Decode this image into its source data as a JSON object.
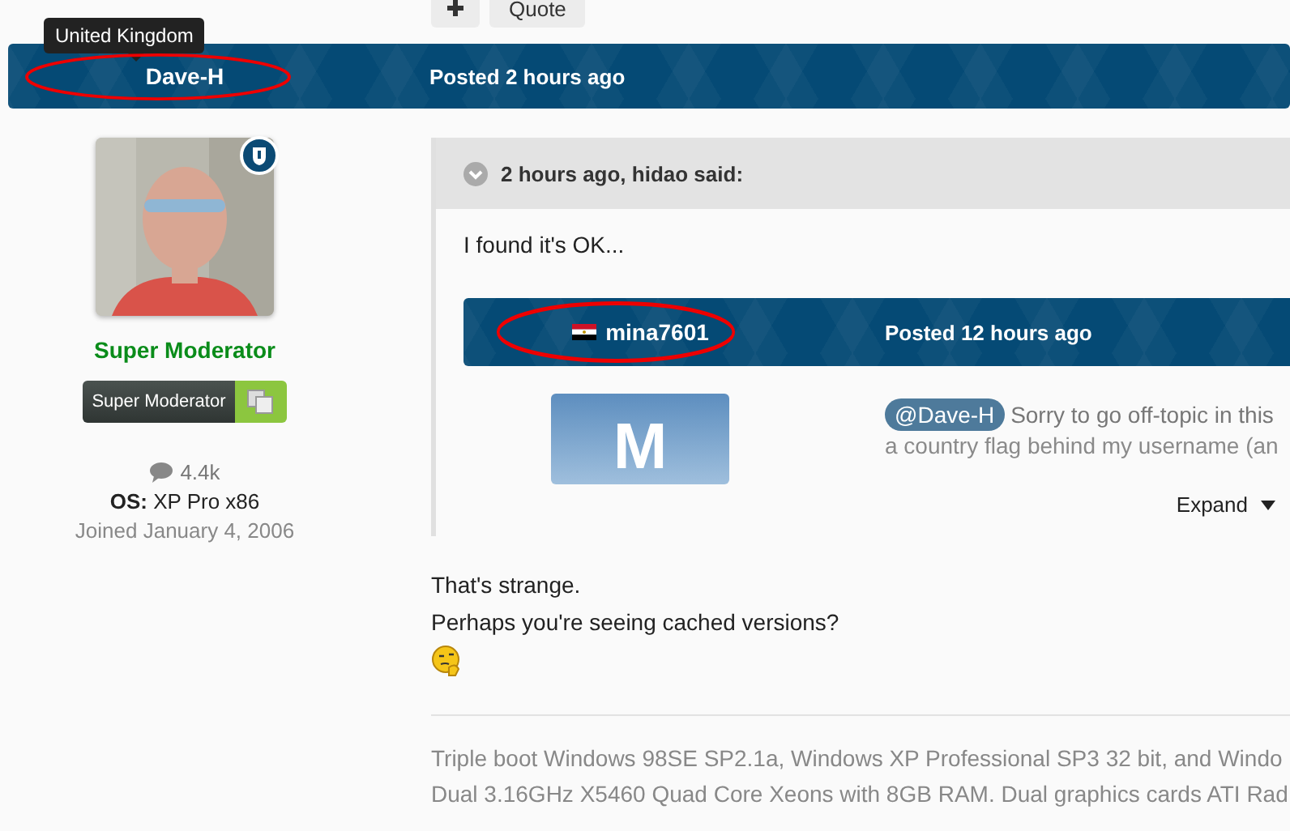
{
  "toolbar": {
    "buttons": [
      {
        "kind": "plus"
      },
      {
        "kind": "text",
        "label": "Quote"
      }
    ]
  },
  "post": {
    "author": "Dave-H",
    "author_tooltip": "United Kingdom",
    "posted": "Posted 2 hours ago",
    "author_panel": {
      "role": "Super Moderator",
      "badge": "Super Moderator",
      "posts": "4.4k",
      "os_label": "OS:",
      "os_value": "XP Pro x86",
      "joined": "Joined January 4, 2006"
    },
    "quote": {
      "header": "2 hours ago, hidao said:",
      "text": "I found it's OK...",
      "nested_post": {
        "author": "mina7601",
        "posted": "Posted 12 hours ago",
        "avatar_letter": "M",
        "mention": "@Dave-H",
        "text": "Sorry to go off-topic in this",
        "text_2": "a country flag behind my username (an"
      },
      "expand": "Expand"
    },
    "body": [
      "That's strange.",
      "Perhaps you're seeing cached versions?"
    ],
    "signature": [
      "Triple boot Windows 98SE SP2.1a, Windows XP Professional SP3 32 bit, and Windo",
      "Dual 3.16GHz X5460 Quad Core Xeons with 8GB RAM. Dual graphics cards ATI Rad"
    ]
  }
}
